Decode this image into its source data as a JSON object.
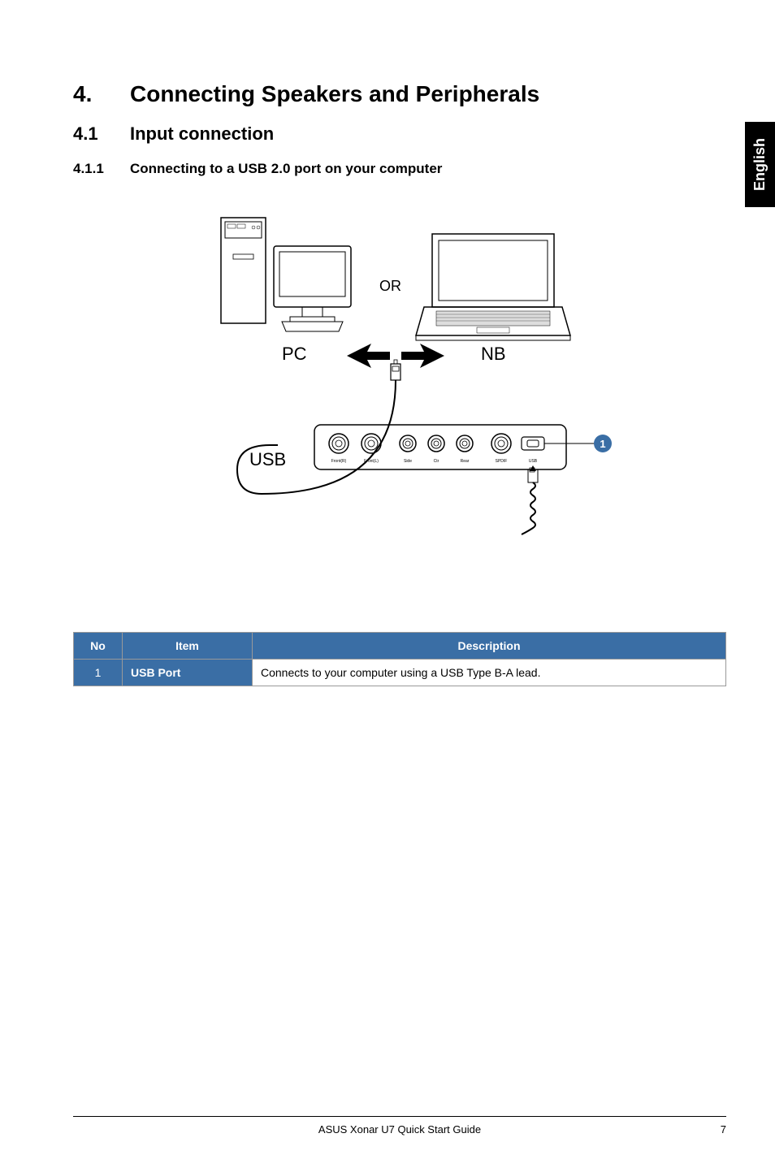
{
  "sideTab": "English",
  "h1_num": "4.",
  "h1_text": "Connecting Speakers and Peripherals",
  "h2_num": "4.1",
  "h2_text": "Input connection",
  "h3_num": "4.1.1",
  "h3_text": "Connecting to a USB 2.0 port on your computer",
  "diagram": {
    "or": "OR",
    "pc": "PC",
    "nb": "NB",
    "usb": "USB",
    "callout": "1",
    "ports": [
      "Front(R)",
      "Front(L)",
      "Side",
      "Ctr",
      "Rear",
      "SPDIF",
      "USB"
    ]
  },
  "table": {
    "headers": [
      "No",
      "Item",
      "Description"
    ],
    "rows": [
      {
        "no": "1",
        "item": "USB Port",
        "desc": "Connects to your computer using a USB Type B-A lead."
      }
    ]
  },
  "footer": {
    "title": "ASUS Xonar U7 Quick Start Guide",
    "page": "7"
  }
}
